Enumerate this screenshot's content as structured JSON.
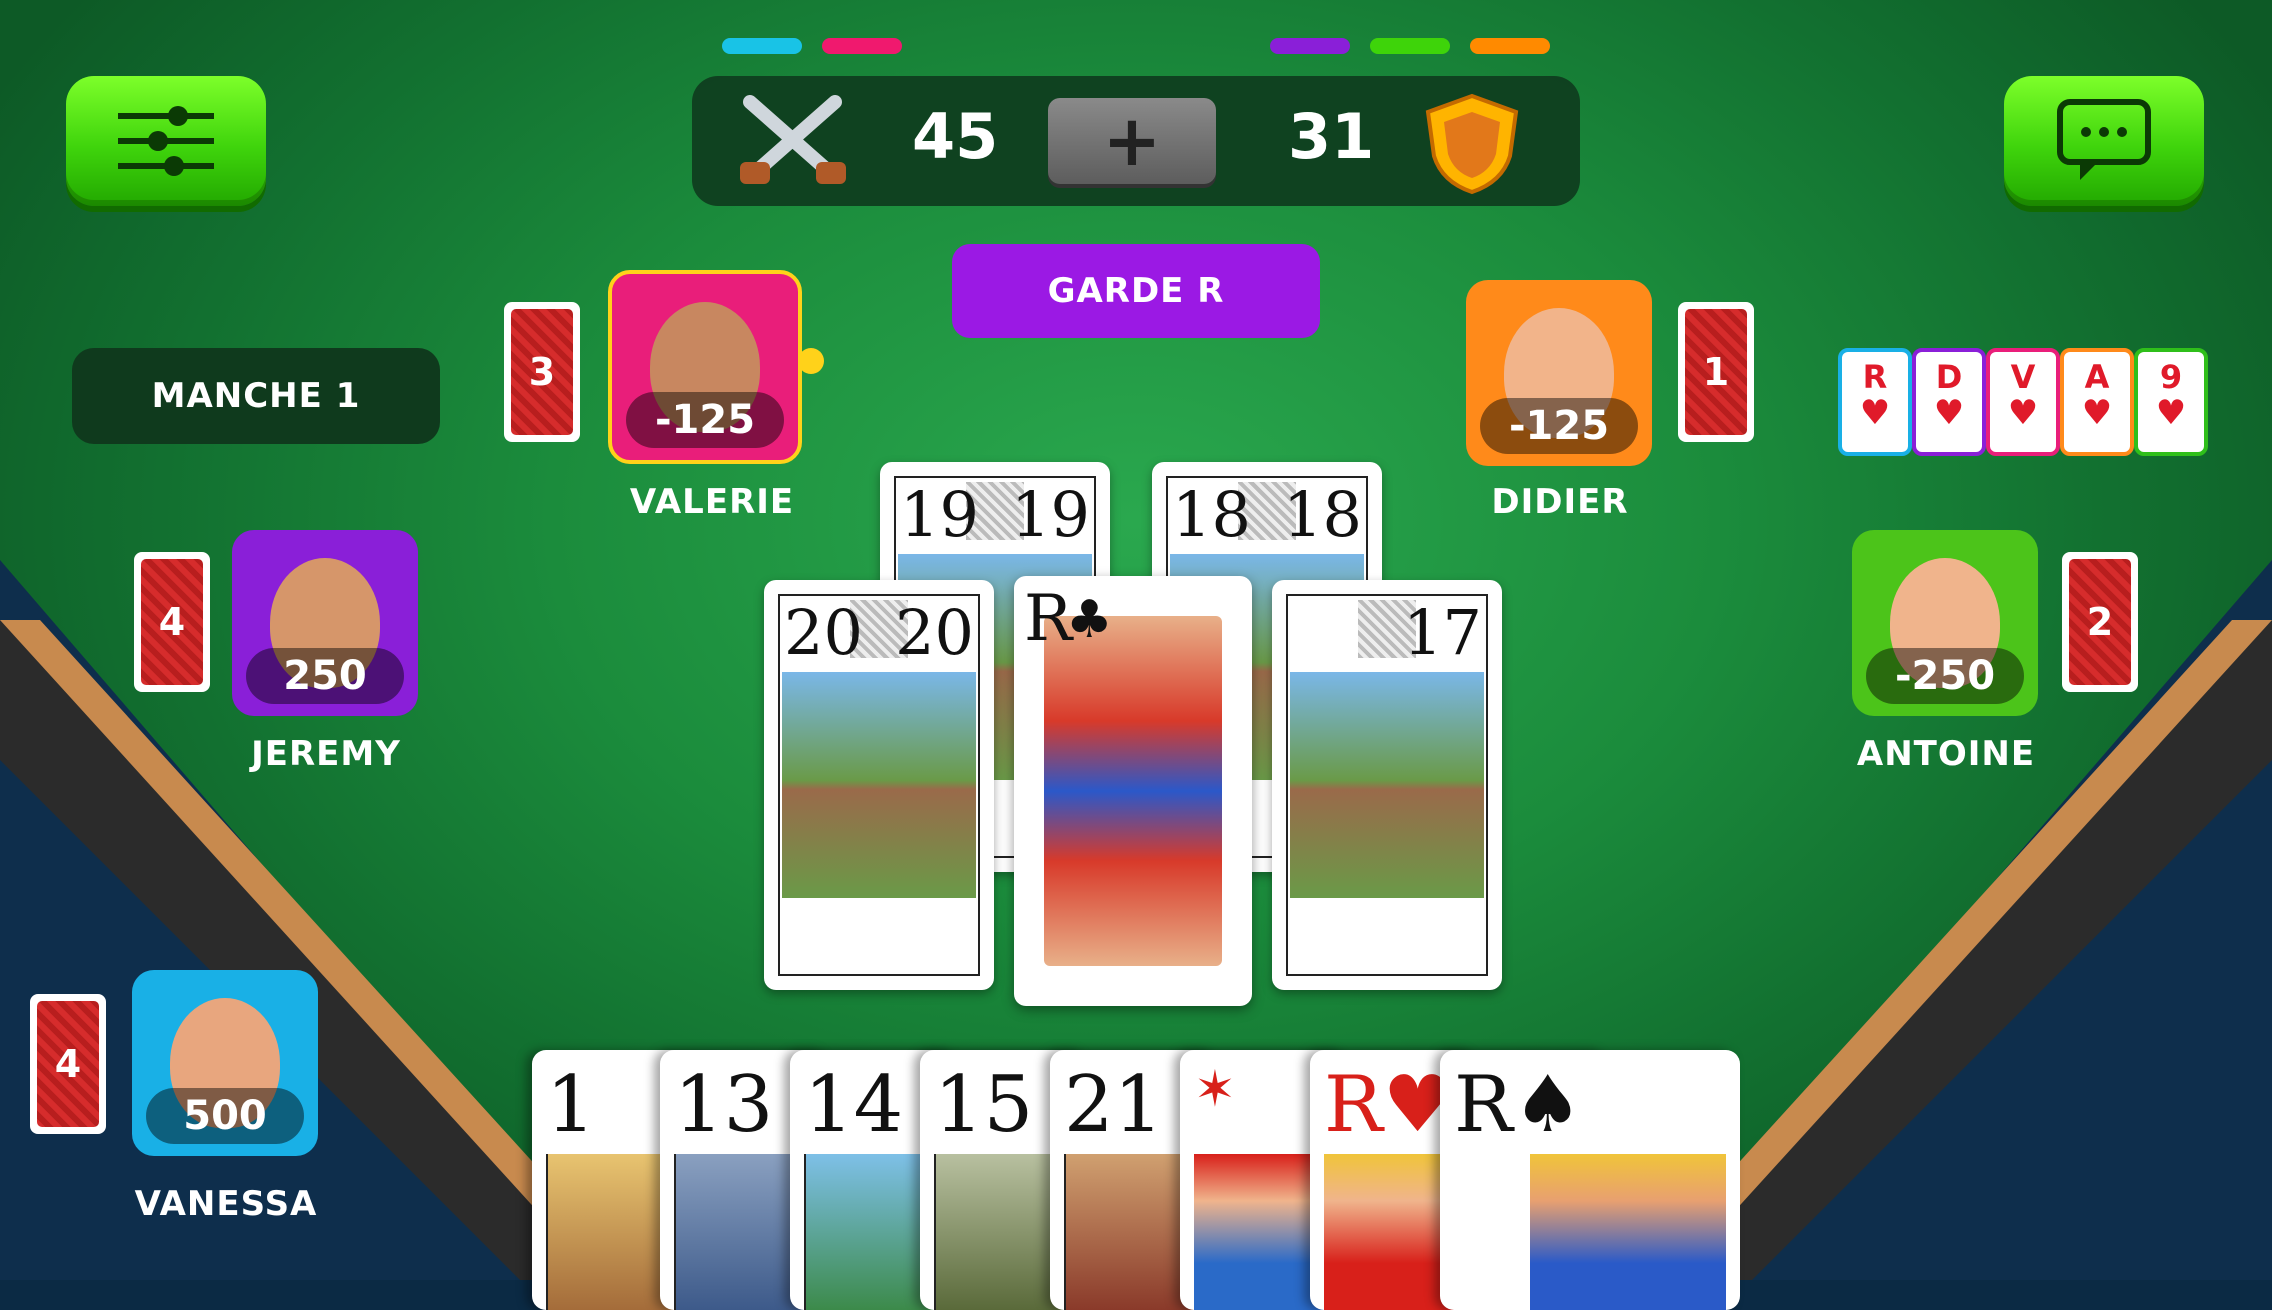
{
  "colors": {
    "accent_purple": "#9b19e4",
    "button_green": "#3fd40c",
    "felt": "#1b8c3c"
  },
  "top_bars": [
    {
      "color": "#19c3e6"
    },
    {
      "color": "#f0196e"
    },
    {
      "color": "#8a1fd8"
    },
    {
      "color": "#3ed40a"
    },
    {
      "color": "#ff8a00"
    }
  ],
  "header": {
    "settings_icon": "sliders-icon",
    "chat_icon": "chat-bubble-icon",
    "attack_icon": "crossed-swords-icon",
    "defense_icon": "shield-icon",
    "attack_score": "45",
    "defense_score": "31",
    "plus_label": "+"
  },
  "contract": "GARDE R",
  "round_label": "MANCHE 1",
  "players": [
    {
      "name": "VALERIE",
      "score": "-125",
      "cards": "3",
      "color": "#e91e7a"
    },
    {
      "name": "DIDIER",
      "score": "-125",
      "cards": "1",
      "color": "#ff8a1a"
    },
    {
      "name": "JEREMY",
      "score": "250",
      "cards": "4",
      "color": "#8a1fd8"
    },
    {
      "name": "ANTOINE",
      "score": "-250",
      "cards": "2",
      "color": "#4cc41a"
    },
    {
      "name": "VANESSA",
      "score": "500",
      "cards": "4",
      "color": "#19b0e6"
    }
  ],
  "called_cards": [
    {
      "rank": "R",
      "border": "#19b0e6"
    },
    {
      "rank": "D",
      "border": "#8a1fd8"
    },
    {
      "rank": "V",
      "border": "#e91e7a"
    },
    {
      "rank": "A",
      "border": "#ff8a1a"
    },
    {
      "rank": "9",
      "border": "#2fbf1a"
    }
  ],
  "table_cards": {
    "top_left": "19",
    "top_right": "18",
    "left": "20",
    "right": "17",
    "center_rank": "R",
    "center_suit": "♣"
  },
  "hand": [
    {
      "label": "1"
    },
    {
      "label": "13"
    },
    {
      "label": "14"
    },
    {
      "label": "15"
    },
    {
      "label": "21"
    },
    {
      "label": "✶"
    },
    {
      "label": "R♥"
    },
    {
      "label": "R♠"
    }
  ]
}
